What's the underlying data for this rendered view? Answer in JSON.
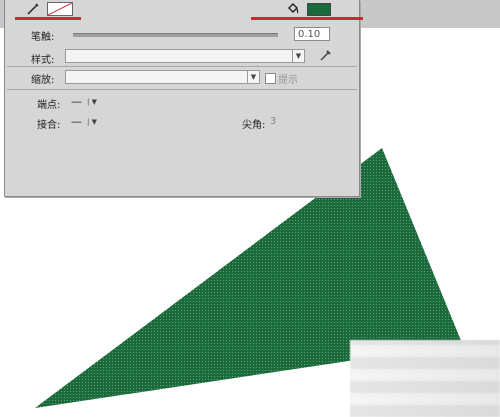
{
  "colors": {
    "fill": "#1a6a3c",
    "stroke": "#ffffff",
    "panel_bg": "#d6d6d6",
    "highlight_underline": "#c42b33"
  },
  "icons": {
    "stroke_tool": "pencil-icon",
    "fill_tool": "paint-bucket-icon",
    "eyedropper": "eyedropper-icon"
  },
  "properties": {
    "stroke_label": "笔触:",
    "stroke_value": "0.10",
    "style_label": "样式:",
    "scale_label": "缩放:",
    "hint_label": "提示",
    "hint_checked": false,
    "cap_label": "端点:",
    "cap_value": "—",
    "join_label": "接合:",
    "join_value": "—",
    "miter_label": "尖角:",
    "miter_value": "3"
  }
}
